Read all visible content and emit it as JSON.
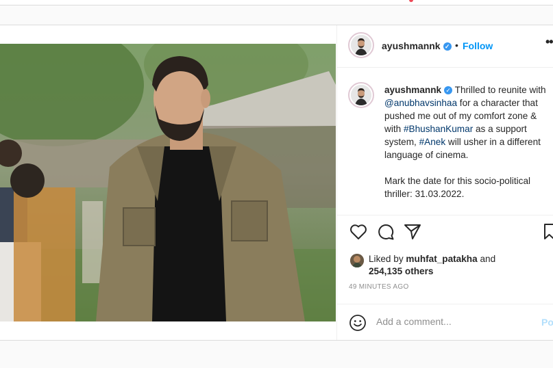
{
  "post": {
    "username": "ayushmannk",
    "verified_icon": "verified-badge-icon",
    "separator": "•",
    "follow_label": "Follow",
    "more_icon": "ellipsis-icon",
    "more_label": "•••",
    "caption": {
      "username": "ayushmannk",
      "t1": " Thrilled to reunite with ",
      "mention": "@anubhavsinhaa",
      "t2": " for a character that pushed me out of my comfort zone & with ",
      "hashtag1": "#BhushanKumar",
      "t3": " as a support system, ",
      "hashtag2": "#Anek",
      "t4": " will usher in a different language of cinema.",
      "paragraph2": "Mark the date for this socio-political thriller: 31.03.2022."
    },
    "actions": [
      "heart-icon",
      "comment-icon",
      "share-icon",
      "bookmark-icon"
    ],
    "likes": {
      "prefix": "Liked by ",
      "liker": "muhfat_patakha",
      "middle": " and",
      "count": "254,135 others"
    },
    "time": "49 MINUTES AGO",
    "comment": {
      "placeholder": "Add a comment...",
      "emoji_icon": "smiley-icon",
      "post_label": "Po"
    }
  },
  "colors": {
    "accent": "#0095f6",
    "verified": "#3897f0",
    "link": "#00376b",
    "muted": "#8e8e8e",
    "border": "#dbdbdb"
  }
}
